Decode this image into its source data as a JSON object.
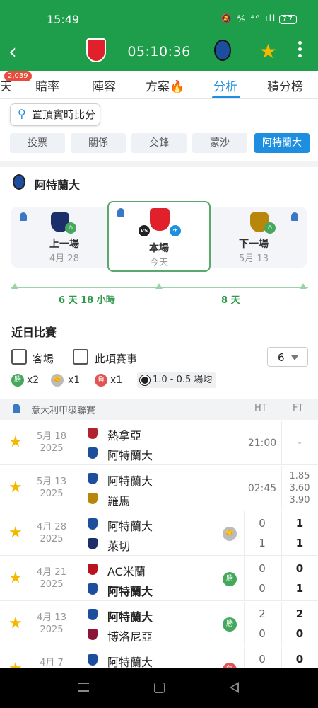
{
  "status": {
    "time": "15:49",
    "icons": "🔕 ⅍ ⁴ᴳ ıll",
    "battery": "77"
  },
  "header": {
    "score": "05:10:36"
  },
  "tabs": [
    {
      "label": "天"
    },
    {
      "label": "賠率"
    },
    {
      "label": "陣容"
    },
    {
      "label": "方案🔥"
    },
    {
      "label": "分析"
    },
    {
      "label": "積分榜"
    }
  ],
  "badge": "2,039",
  "pin_label": "置頂實時比分",
  "segments": [
    "投票",
    "關係",
    "交鋒",
    "蒙沙",
    "阿特蘭大"
  ],
  "team_header": "阿特蘭大",
  "timeline": {
    "prev": {
      "label": "上一場",
      "date": "4月 28"
    },
    "current": {
      "label": "本場",
      "date": "今天"
    },
    "next": {
      "label": "下一場",
      "date": "5月 13"
    },
    "gap_prev": "6 天 18 小時",
    "gap_next": "8 天"
  },
  "recent": {
    "title": "近日比賽",
    "filter_away": "客場",
    "filter_comp": "此項賽事",
    "count": "6",
    "stats": [
      {
        "badge": "勝",
        "text": "x2",
        "color": "#45a85d"
      },
      {
        "badge": "🤝",
        "text": "x1",
        "color": "#bbbbbb"
      },
      {
        "badge": "負",
        "text": "x1",
        "color": "#e25555"
      }
    ],
    "avg": "1.0 - 0.5 場均"
  },
  "league": {
    "name": "意大利甲级聯賽",
    "ht": "HT",
    "ft": "FT"
  },
  "matches": [
    {
      "date1": "5月 18",
      "date2": "2025",
      "home": "熱拿亞",
      "away": "阿特蘭大",
      "kick": "21:00",
      "dash": "-"
    },
    {
      "date1": "5月 13",
      "date2": "2025",
      "home": "阿特蘭大",
      "away": "羅馬",
      "kick": "02:45",
      "odds": [
        "1.85",
        "3.60",
        "3.90"
      ]
    },
    {
      "date1": "4月 28",
      "date2": "2025",
      "home": "阿特蘭大",
      "away": "萊切",
      "ht1": "0",
      "ht2": "1",
      "ft1": "1",
      "ft2": "1",
      "result": "🤝"
    },
    {
      "date1": "4月 21",
      "date2": "2025",
      "home": "AC米蘭",
      "away": "阿特蘭大",
      "ht1": "0",
      "ht2": "0",
      "ft1": "0",
      "ft2": "1",
      "result": "勝"
    },
    {
      "date1": "4月 13",
      "date2": "2025",
      "home": "阿特蘭大",
      "away": "博洛尼亞",
      "ht1": "2",
      "ht2": "0",
      "ft1": "2",
      "ft2": "0",
      "result": "勝"
    },
    {
      "date1": "4月 7",
      "date2": "",
      "home": "阿特蘭大",
      "away": "",
      "ht1": "0",
      "ft1": "0",
      "result": "負"
    }
  ]
}
